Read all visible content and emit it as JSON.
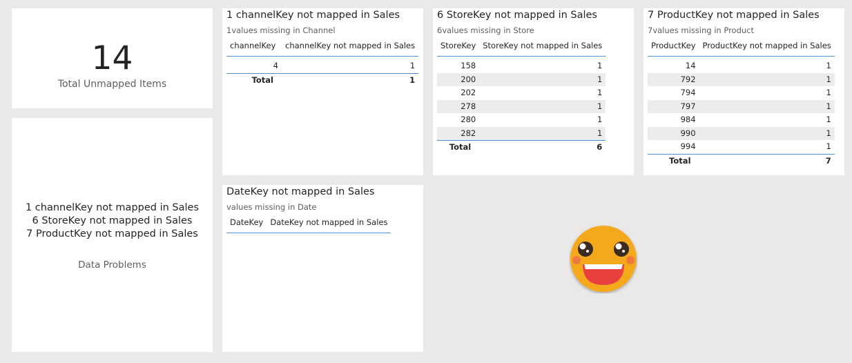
{
  "kpi": {
    "value": "14",
    "label": "Total Unmapped Items"
  },
  "problems": {
    "lines": [
      "1 channelKey not mapped in Sales",
      "6 StoreKey not mapped in Sales",
      "7 ProductKey not mapped in Sales"
    ],
    "label": "Data Problems"
  },
  "channel": {
    "title": "1 channelKey not mapped in Sales",
    "subtitle": "1values missing in Channel",
    "col1": "channelKey",
    "col2": "channelKey not mapped in Sales",
    "rows": [
      [
        "4",
        "1"
      ]
    ],
    "total_label": "Total",
    "total_value": "1"
  },
  "store": {
    "title": "6 StoreKey not mapped in Sales",
    "subtitle": "6values missing in Store",
    "col1": "StoreKey",
    "col2": "StoreKey not mapped in Sales",
    "rows": [
      [
        "158",
        "1"
      ],
      [
        "200",
        "1"
      ],
      [
        "202",
        "1"
      ],
      [
        "278",
        "1"
      ],
      [
        "280",
        "1"
      ],
      [
        "282",
        "1"
      ]
    ],
    "total_label": "Total",
    "total_value": "6"
  },
  "product": {
    "title": "7 ProductKey not mapped in Sales",
    "subtitle": "7values missing in Product",
    "col1": "ProductKey",
    "col2": "ProductKey not mapped in Sales",
    "rows": [
      [
        "14",
        "1"
      ],
      [
        "792",
        "1"
      ],
      [
        "794",
        "1"
      ],
      [
        "797",
        "1"
      ],
      [
        "984",
        "1"
      ],
      [
        "990",
        "1"
      ],
      [
        "994",
        "1"
      ]
    ],
    "total_label": "Total",
    "total_value": "7"
  },
  "datekey": {
    "title": "DateKey not mapped in Sales",
    "subtitle": "values missing in Date",
    "col1": "DateKey",
    "col2": "DateKey not mapped in Sales"
  },
  "icons": {
    "smiley": "happy-face-icon"
  },
  "colors": {
    "accent_line": "#4a90d9",
    "alt_row": "#ececec",
    "smiley_face": "#f4a81d",
    "smiley_mouth": "#e8403f"
  }
}
